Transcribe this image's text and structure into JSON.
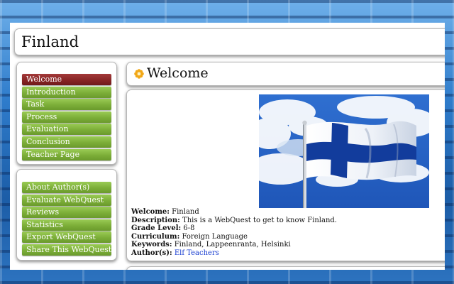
{
  "page": {
    "title": "Finland"
  },
  "nav_primary": {
    "items": [
      {
        "label": "Welcome",
        "active": true
      },
      {
        "label": "Introduction",
        "active": false
      },
      {
        "label": "Task",
        "active": false
      },
      {
        "label": "Process",
        "active": false
      },
      {
        "label": "Evaluation",
        "active": false
      },
      {
        "label": "Conclusion",
        "active": false
      },
      {
        "label": "Teacher Page",
        "active": false
      }
    ]
  },
  "nav_secondary": {
    "items": [
      {
        "label": "About Author(s)"
      },
      {
        "label": "Evaluate WebQuest"
      },
      {
        "label": "Reviews"
      },
      {
        "label": "Statistics"
      },
      {
        "label": "Export WebQuest"
      },
      {
        "label": "Share This WebQuest"
      }
    ]
  },
  "main": {
    "heading": "Welcome",
    "heading_icon": "flower-icon",
    "image": {
      "subject": "finland-flag-image"
    },
    "info": {
      "welcome": {
        "label": "Welcome:",
        "value": "Finland"
      },
      "description": {
        "label": "Description:",
        "value": "This is a WebQuest to get to know Finland."
      },
      "grade_level": {
        "label": "Grade Level:",
        "value": "6-8"
      },
      "curriculum": {
        "label": "Curriculum:",
        "value": "Foreign Language"
      },
      "keywords": {
        "label": "Keywords:",
        "value": "Finland, Lappeenranta, Helsinki"
      },
      "authors": {
        "label": "Author(s):",
        "value": "Elf Teachers"
      }
    }
  },
  "colors": {
    "menu_green": "#7cae38",
    "menu_active": "#862424",
    "link_blue": "#1a3fd1",
    "background_blue": "#2a6fb8"
  }
}
